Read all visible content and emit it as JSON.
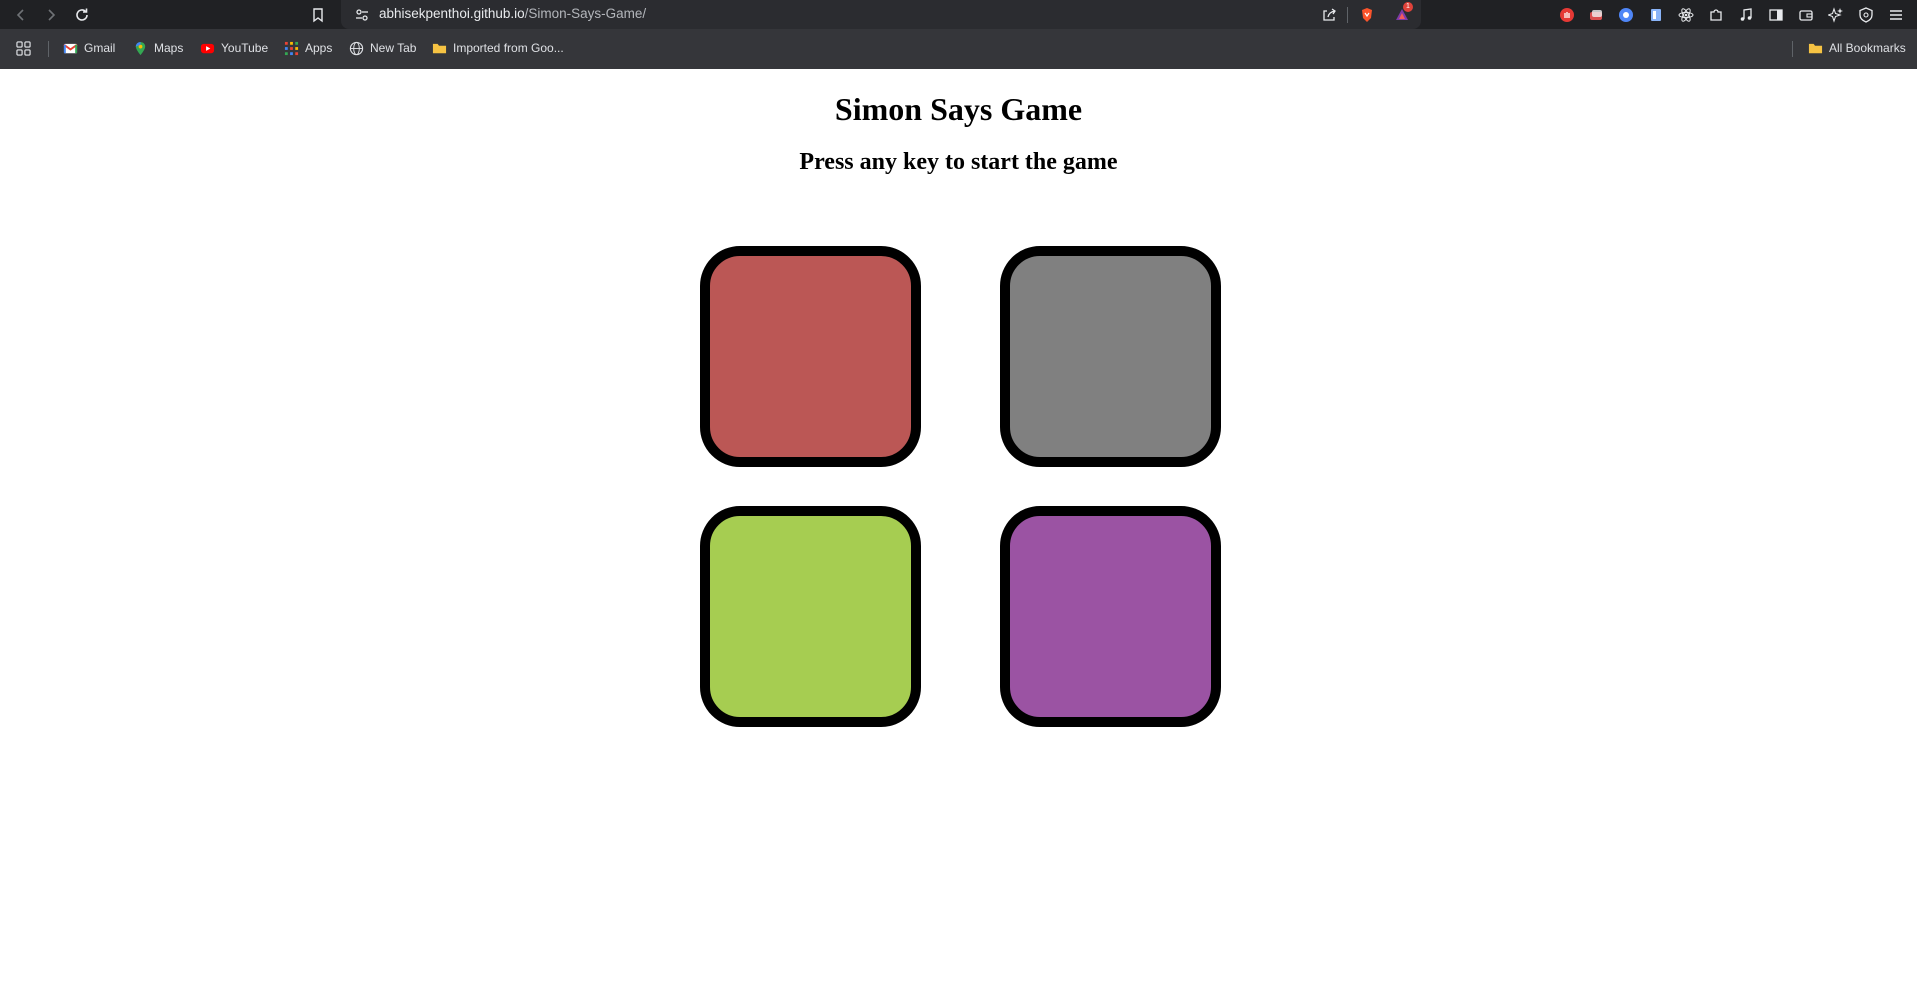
{
  "browser": {
    "url_host": "abhisekpenthoi.github.io",
    "url_path": "/Simon-Says-Game/",
    "bookmarks": [
      {
        "label": "Gmail",
        "icon": "gmail-icon"
      },
      {
        "label": "Maps",
        "icon": "maps-icon"
      },
      {
        "label": "YouTube",
        "icon": "youtube-icon"
      },
      {
        "label": "Apps",
        "icon": "apps-grid-icon"
      },
      {
        "label": "New Tab",
        "icon": "globe-icon"
      },
      {
        "label": "Imported from Goo...",
        "icon": "folder-icon"
      }
    ],
    "all_bookmarks_label": "All Bookmarks",
    "notification_count": "1"
  },
  "page": {
    "title": "Simon Says Game",
    "subtitle": "Press any key to start the game"
  },
  "game": {
    "buttons": [
      {
        "name": "red",
        "color": "#bb5755"
      },
      {
        "name": "gray",
        "color": "#808080"
      },
      {
        "name": "green",
        "color": "#a6cd51"
      },
      {
        "name": "purple",
        "color": "#9b53a3"
      }
    ]
  }
}
